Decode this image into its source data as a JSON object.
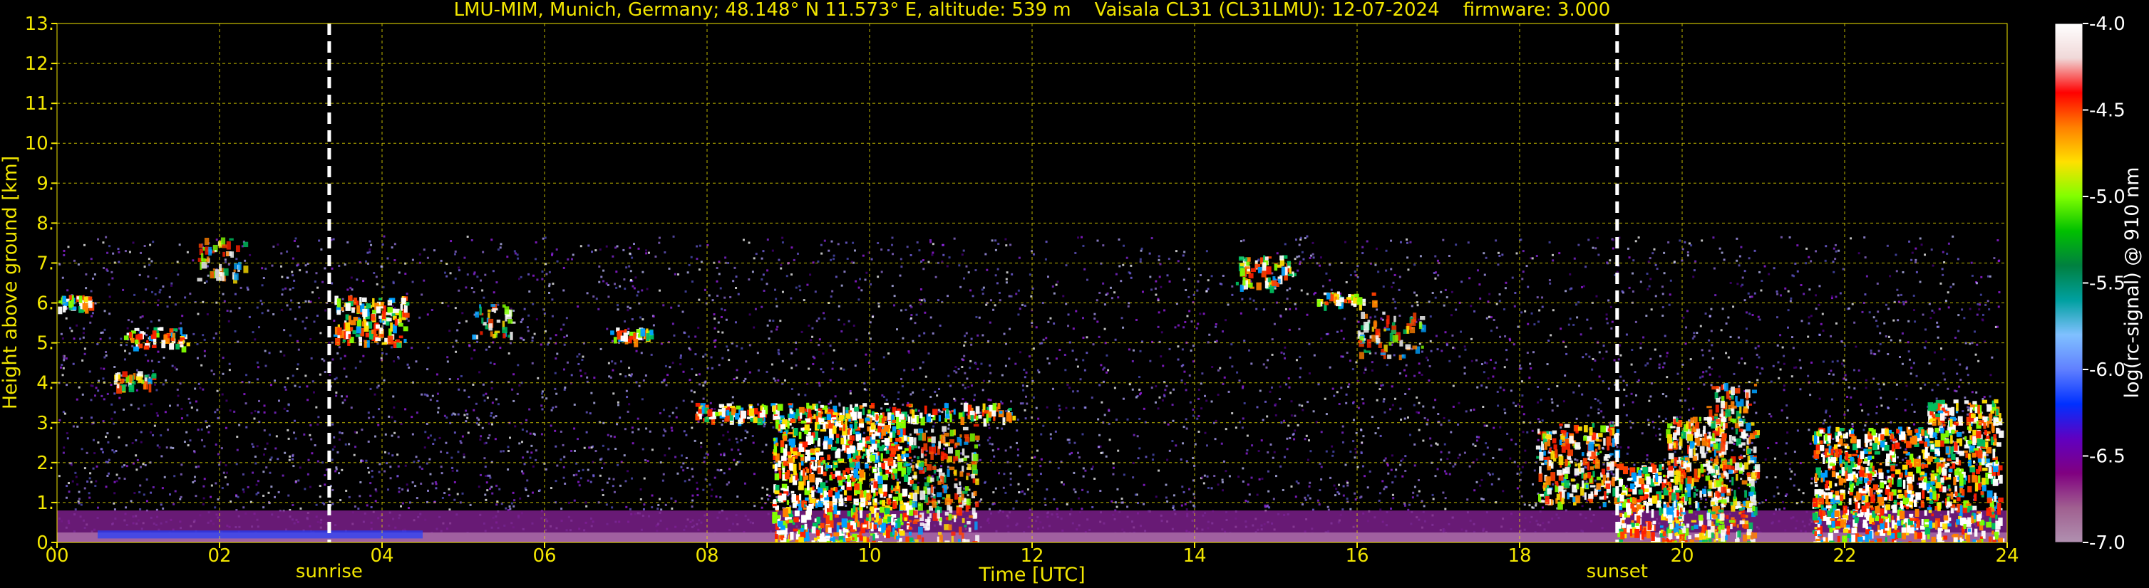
{
  "chart_data": {
    "type": "heatmap",
    "title": "LMU-MIM, Munich, Germany; 48.148° N 11.573° E, altitude: 539 m    Vaisala CL31 (CL31LMU): 12-07-2024    firmware: 3.000",
    "xlabel": "Time [UTC]",
    "ylabel": "Height above ground [km]",
    "xlim": [
      0,
      24
    ],
    "ylim": [
      0,
      13
    ],
    "x_ticks": [
      "00",
      "02",
      "04",
      "06",
      "08",
      "10",
      "12",
      "14",
      "16",
      "18",
      "20",
      "22",
      "24"
    ],
    "y_ticks": [
      "0.",
      "1.",
      "2.",
      "3.",
      "4.",
      "5.",
      "6.",
      "7.",
      "8.",
      "9.",
      "10.",
      "11.",
      "12.",
      "13."
    ],
    "grid": true,
    "annotations": [
      {
        "label": "sunrise",
        "x": 3.35
      },
      {
        "label": "sunset",
        "x": 19.2
      }
    ],
    "colorbar": {
      "label": "log(rc-signal) @ 910 nm",
      "range": [
        -7.0,
        -4.0
      ],
      "ticks": [
        "-4.0",
        "-4.5",
        "-5.0",
        "-5.5",
        "-6.0",
        "-6.5",
        "-7.0"
      ],
      "colors": [
        "#ffffff",
        "#f0d8d8",
        "#ff0000",
        "#ff8000",
        "#ffe000",
        "#80ff00",
        "#00c000",
        "#008040",
        "#00a0a0",
        "#80c0ff",
        "#6080ff",
        "#0030ff",
        "#6000c0",
        "#800080",
        "#a06090",
        "#b090b0"
      ]
    },
    "features": [
      {
        "type": "noise_background",
        "x0": 0,
        "x1": 23.9,
        "y0": 0,
        "y1": 7.7
      },
      {
        "type": "boundary_layer",
        "x0": 0,
        "x1": 24,
        "y0": 0,
        "y1": 0.8
      },
      {
        "type": "cloud",
        "x0": 0.0,
        "x1": 0.4,
        "y0": 5.9,
        "y1": 6.2,
        "intensity": 0.9
      },
      {
        "type": "cloud",
        "x0": 0.8,
        "x1": 1.6,
        "y0": 4.9,
        "y1": 5.4,
        "intensity": 0.9
      },
      {
        "type": "cloud",
        "x0": 0.7,
        "x1": 1.2,
        "y0": 3.9,
        "y1": 4.3,
        "intensity": 0.7
      },
      {
        "type": "cloud",
        "x0": 1.7,
        "x1": 2.3,
        "y0": 6.6,
        "y1": 7.7,
        "intensity": 0.5
      },
      {
        "type": "cloud",
        "x0": 3.4,
        "x1": 4.3,
        "y0": 5.0,
        "y1": 6.2,
        "intensity": 0.9
      },
      {
        "type": "cloud",
        "x0": 5.1,
        "x1": 5.6,
        "y0": 5.2,
        "y1": 6.0,
        "intensity": 0.6
      },
      {
        "type": "cloud",
        "x0": 6.8,
        "x1": 7.3,
        "y0": 5.1,
        "y1": 5.4,
        "intensity": 0.9
      },
      {
        "type": "cloud",
        "x0": 7.8,
        "x1": 11.8,
        "y0": 3.1,
        "y1": 3.5,
        "intensity": 0.9
      },
      {
        "type": "cloud",
        "x0": 8.8,
        "x1": 10.5,
        "y0": 0,
        "y1": 3.3,
        "intensity": 1.0
      },
      {
        "type": "cloud",
        "x0": 10.5,
        "x1": 11.3,
        "y0": 0,
        "y1": 3.0,
        "intensity": 0.6
      },
      {
        "type": "cloud",
        "x0": 14.5,
        "x1": 15.2,
        "y0": 6.4,
        "y1": 7.2,
        "intensity": 0.8
      },
      {
        "type": "cloud",
        "x0": 15.5,
        "x1": 16.2,
        "y0": 6.0,
        "y1": 6.3,
        "intensity": 0.9
      },
      {
        "type": "cloud",
        "x0": 16.0,
        "x1": 16.8,
        "y0": 4.7,
        "y1": 5.8,
        "intensity": 0.5
      },
      {
        "type": "cloud",
        "x0": 18.2,
        "x1": 19.2,
        "y0": 1.0,
        "y1": 3.0,
        "intensity": 0.8
      },
      {
        "type": "cloud",
        "x0": 19.2,
        "x1": 20.0,
        "y0": 0,
        "y1": 2.0,
        "intensity": 1.0
      },
      {
        "type": "cloud",
        "x0": 19.8,
        "x1": 20.5,
        "y0": 0,
        "y1": 3.2,
        "intensity": 0.8
      },
      {
        "type": "cloud",
        "x0": 20.3,
        "x1": 20.9,
        "y0": 0,
        "y1": 4.0,
        "intensity": 0.7
      },
      {
        "type": "cloud",
        "x0": 21.6,
        "x1": 23.0,
        "y0": 0,
        "y1": 2.9,
        "intensity": 1.0
      },
      {
        "type": "cloud",
        "x0": 23.0,
        "x1": 23.9,
        "y0": 0,
        "y1": 3.6,
        "intensity": 0.9
      }
    ]
  }
}
